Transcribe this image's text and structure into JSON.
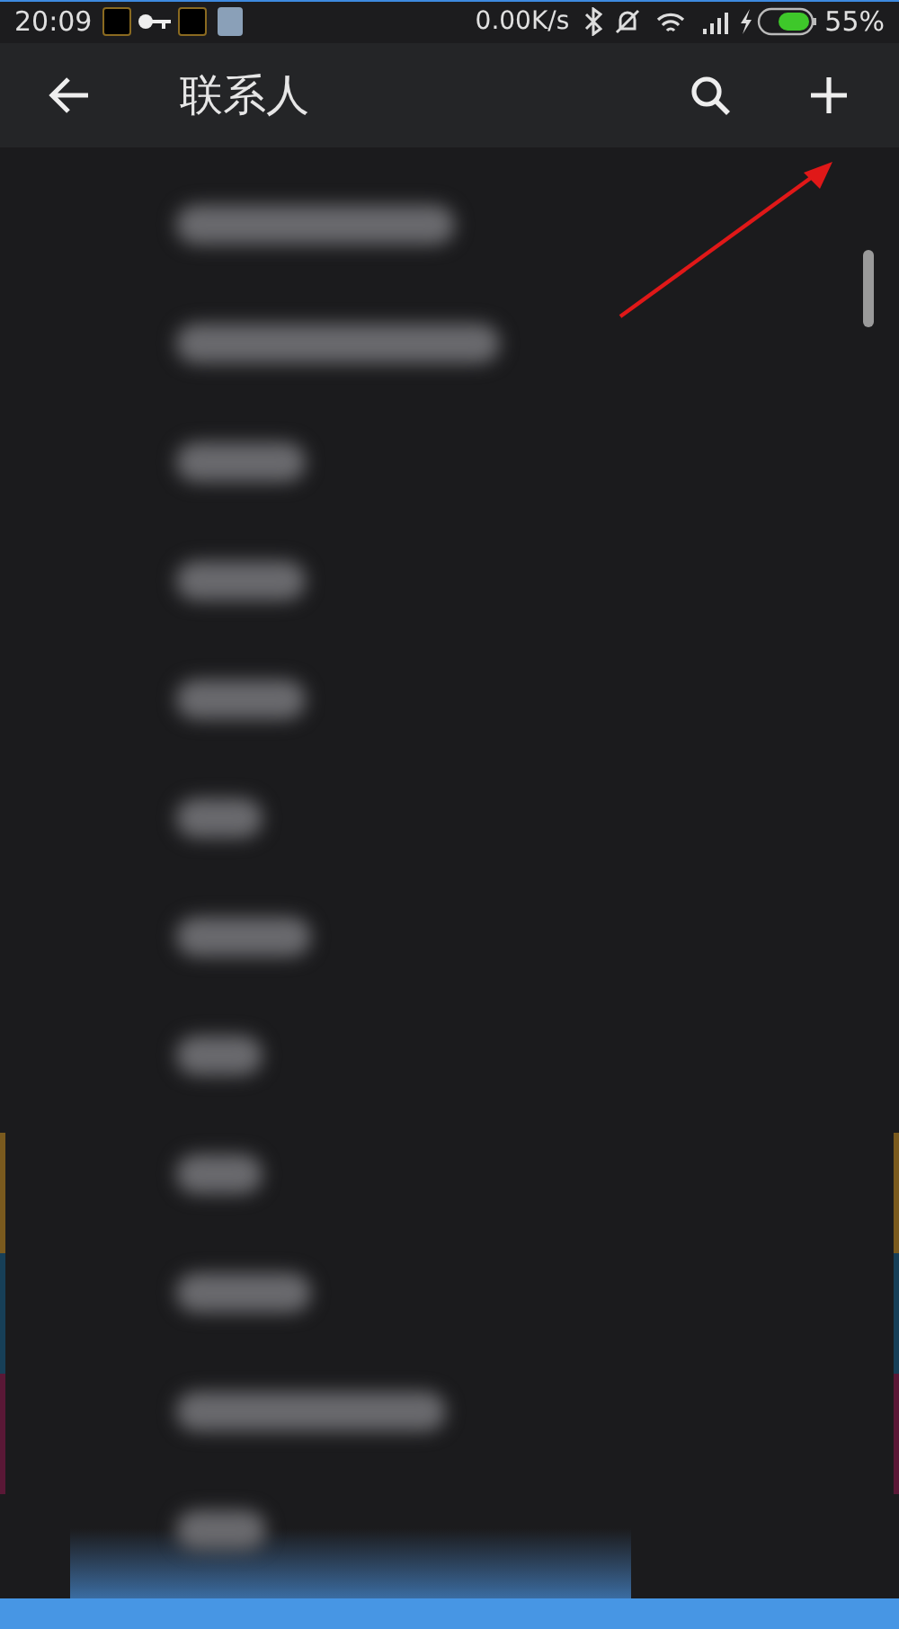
{
  "status_bar": {
    "time": "20:09",
    "speed": "0.00K/s",
    "battery": "55%"
  },
  "app_bar": {
    "title": "联系人"
  },
  "contacts": [
    {
      "kind": "blurred"
    },
    {
      "kind": "blurred"
    },
    {
      "kind": "blurred"
    },
    {
      "kind": "blurred"
    },
    {
      "kind": "blurred"
    },
    {
      "kind": "blurred"
    },
    {
      "kind": "blurred"
    },
    {
      "kind": "blurred"
    },
    {
      "kind": "blurred"
    },
    {
      "kind": "blurred"
    },
    {
      "kind": "blurred"
    },
    {
      "kind": "blurred"
    }
  ],
  "side_markers": [
    {
      "color": "#7a5a1e"
    },
    {
      "color": "#173f57"
    },
    {
      "color": "#5a1836"
    }
  ]
}
